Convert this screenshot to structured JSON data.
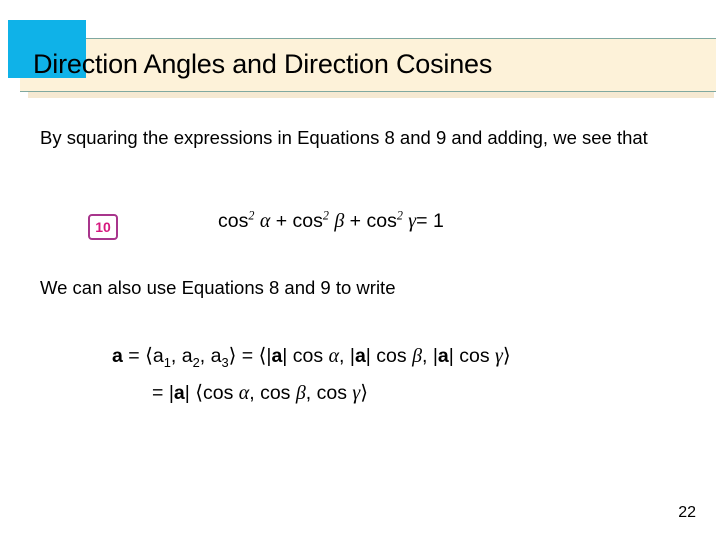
{
  "slide": {
    "title": "Direction Angles and Direction Cosines",
    "page_number": "22",
    "accent_color": "#0fb2e8",
    "banner_color": "#fdf2d9",
    "banner_rule_color": "#7fa8a0",
    "badge_border_color": "#a8358c",
    "badge_text_color": "#d6187f",
    "background_color": "#ffffff"
  },
  "body": {
    "paragraph_1": "By squaring the expressions in Equations 8 and 9 and adding, we see that",
    "paragraph_2": "We can also use Equations 8 and 9 to write"
  },
  "equation": {
    "number": "10",
    "cos": "cos",
    "exponent": "2",
    "alpha": "α",
    "beta": "β",
    "gamma": "γ",
    "plus": "+",
    "equals": "=",
    "one": "1",
    "plain_text": "cos² α + cos² β + cos² γ = 1"
  },
  "vector_equations": {
    "line_1": {
      "vector_name": "a",
      "equals_1": "=",
      "open_angle": "⟨",
      "comp_a": "a",
      "sub_1": "1",
      "sub_2": "2",
      "sub_3": "3",
      "comma": ",",
      "close_angle": "⟩",
      "equals_2": "=",
      "magnitude_open": "|",
      "magnitude_close": "|",
      "cos": "cos",
      "alpha": "α",
      "beta": "β",
      "gamma": "γ",
      "plain_text": "a = ⟨a1, a2, a3⟩ = ⟨|a| cos α, |a| cos β, |a| cos γ⟩"
    },
    "line_2": {
      "equals": "=",
      "magnitude_open": "|",
      "vector_name": "a",
      "magnitude_close": "|",
      "open_angle": "⟨",
      "cos": "cos",
      "alpha": "α",
      "beta": "β",
      "gamma": "γ",
      "comma": ",",
      "close_angle": "⟩",
      "plain_text": "= |a| ⟨cos α, cos β, cos γ⟩"
    }
  }
}
